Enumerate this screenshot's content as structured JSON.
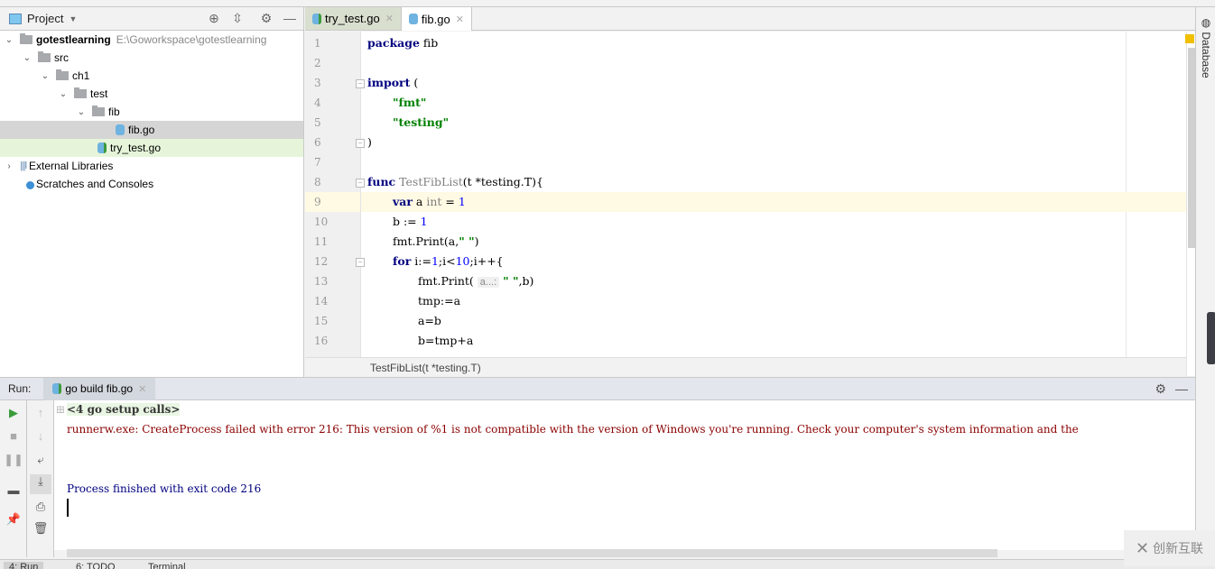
{
  "project_panel": {
    "title": "Project",
    "tree": [
      {
        "label": "gotestlearning",
        "path": "E:\\Goworkspace\\gotestlearning",
        "type": "folder",
        "depth": 0,
        "expanded": true
      },
      {
        "label": "src",
        "type": "folder",
        "depth": 1,
        "expanded": true
      },
      {
        "label": "ch1",
        "type": "folder",
        "depth": 2,
        "expanded": true
      },
      {
        "label": "test",
        "type": "folder",
        "depth": 3,
        "expanded": true
      },
      {
        "label": "fib",
        "type": "folder",
        "depth": 4,
        "expanded": true
      },
      {
        "label": "fib.go",
        "type": "go-file",
        "depth": 5,
        "selected": true
      },
      {
        "label": "try_test.go",
        "type": "go-test-file",
        "depth": 4
      },
      {
        "label": "External Libraries",
        "type": "library",
        "depth": 0,
        "expanded": false
      },
      {
        "label": "Scratches and Consoles",
        "type": "scratches",
        "depth": 0
      }
    ]
  },
  "editor": {
    "tabs": [
      {
        "label": "try_test.go",
        "active": false
      },
      {
        "label": "fib.go",
        "active": true
      }
    ],
    "line_numbers": [
      "1",
      "2",
      "3",
      "4",
      "5",
      "6",
      "7",
      "8",
      "9",
      "10",
      "11",
      "12",
      "13",
      "14",
      "15",
      "16"
    ],
    "current_line": 9,
    "code": {
      "l1_kw": "package",
      "l1_rest": " fib",
      "l3_kw": "import",
      "l3_rest": " (",
      "l4": "\"fmt\"",
      "l5": "\"testing\"",
      "l6": ")",
      "l8_kw": "func",
      "l8_name": " TestFibList",
      "l8_rest": "(t *testing.T){",
      "l9_kw": "var",
      "l9_a": " a ",
      "l9_type": "int",
      "l9_eq": " = ",
      "l9_num": "1",
      "l10_a": "b := ",
      "l10_num": "1",
      "l11_a": "fmt.Print(a,",
      "l11_str": "\" \"",
      "l11_b": ")",
      "l12_kw": "for",
      "l12_a": " i:=",
      "l12_n1": "1",
      "l12_b": ";i<",
      "l12_n2": "10",
      "l12_c": ";i++{",
      "l13_a": "fmt.Print(",
      "l13_hint": "a...:",
      "l13_str": "\" \"",
      "l13_b": ",b)",
      "l14": "tmp:=a",
      "l15": "a=b",
      "l16": "b=tmp+a"
    },
    "breadcrumb": "TestFibList(t *testing.T)"
  },
  "right_stripe": {
    "database_label": "Database"
  },
  "run_panel": {
    "label": "Run:",
    "tab_label": "go build fib.go",
    "console": {
      "setup_calls": "<4 go setup calls>",
      "error": "runnerw.exe: CreateProcess failed with error 216: This version of %1 is not compatible with the version of Windows you're running. Check your computer's system information and the",
      "finished": "Process finished with exit code 216"
    }
  },
  "bottom_tabs": [
    "4: Run",
    "6: TODO",
    "Terminal"
  ],
  "watermark": "创新互联"
}
